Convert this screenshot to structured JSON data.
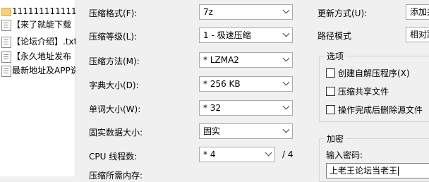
{
  "files": [
    {
      "name": "111111111111",
      "type": "folder"
    },
    {
      "name": "【来了就能下载",
      "type": "txt"
    },
    {
      "name": "【论坛介绍】.txt",
      "type": "txt"
    },
    {
      "name": "【永久地址发布",
      "type": "txt"
    },
    {
      "name": "最新地址及APP说",
      "type": "txt"
    }
  ],
  "settings": {
    "format": {
      "label": "压缩格式(F):",
      "value": "7z"
    },
    "level": {
      "label": "压缩等级(L):",
      "value": "1 - 极速压缩"
    },
    "method": {
      "label": "压缩方法(M):",
      "value": "* LZMA2"
    },
    "dict": {
      "label": "字典大小(D):",
      "value": "* 256 KB"
    },
    "word": {
      "label": "单词大小(W):",
      "value": "* 32"
    },
    "solid": {
      "label": "固实数据大小:",
      "value": "固实"
    },
    "threads": {
      "label": "CPU 线程数:",
      "value": "* 4",
      "max": "/ 4"
    },
    "memory": {
      "label": "压缩所需内存:"
    }
  },
  "right": {
    "update_label": "更新方式(U):",
    "update_value": "添加并",
    "path_label": "路径模式",
    "path_value": "相对路",
    "options_title": "选项",
    "opt_sfx": "创建自解压程序(X)",
    "opt_shared": "压缩共享文件",
    "opt_delete": "操作完成后删除源文件",
    "encrypt_title": "加密",
    "password_label": "输入密码:",
    "password_value": "上老王论坛当老王"
  }
}
